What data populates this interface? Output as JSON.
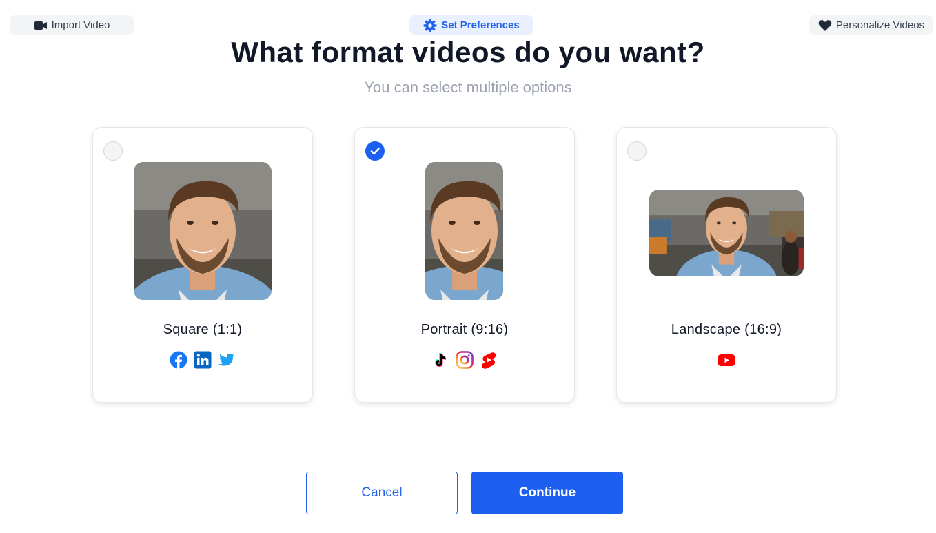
{
  "stepper": {
    "steps": [
      {
        "label": "Import Video",
        "icon": "video-camera-icon",
        "active": false
      },
      {
        "label": "Set Preferences",
        "icon": "gear-icon",
        "active": true
      },
      {
        "label": "Personalize Videos",
        "icon": "heart-icon",
        "active": false
      }
    ]
  },
  "heading": "What format videos do you want?",
  "subtitle": "You can select multiple options",
  "formats": [
    {
      "label": "Square (1:1)",
      "selected": false,
      "platforms": [
        "facebook-icon",
        "linkedin-icon",
        "twitter-icon"
      ]
    },
    {
      "label": "Portrait (9:16)",
      "selected": true,
      "platforms": [
        "tiktok-icon",
        "instagram-icon",
        "youtube-shorts-icon"
      ]
    },
    {
      "label": "Landscape (16:9)",
      "selected": false,
      "platforms": [
        "youtube-icon"
      ]
    }
  ],
  "buttons": {
    "cancel": "Cancel",
    "continue": "Continue"
  },
  "colors": {
    "accent": "#1d5ff0",
    "active_step_bg": "#e8f1fd"
  }
}
